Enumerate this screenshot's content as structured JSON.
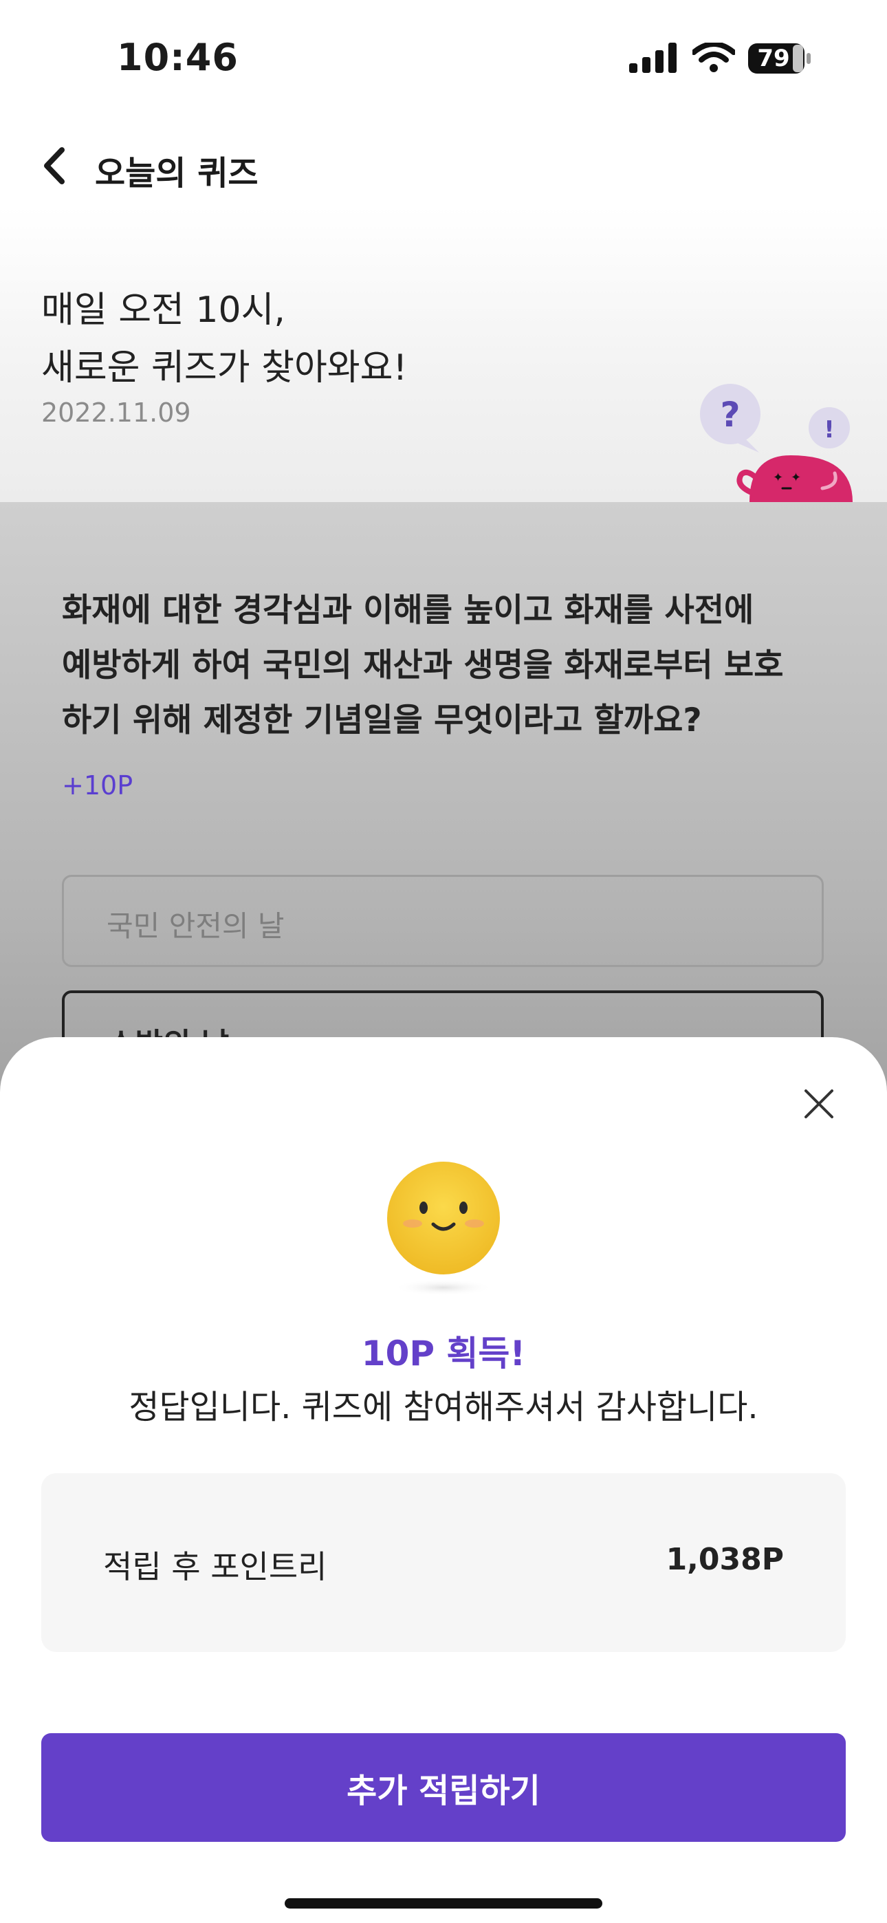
{
  "status_bar": {
    "time": "10:46",
    "battery": "79",
    "icons": [
      "signal-icon",
      "wifi-icon",
      "battery-icon"
    ]
  },
  "nav": {
    "title": "오늘의 퀴즈",
    "back_icon": "chevron-left-icon"
  },
  "hero": {
    "line1": "매일 오전 10시,",
    "line2": "새로운 퀴즈가 찾아와요!",
    "date": "2022.11.09",
    "mascot_marks": [
      "?",
      "!"
    ]
  },
  "quiz": {
    "question_lines": [
      "화재에 대한 경각심과 이해를 높이고 화재를 사전에",
      "예방하게 하여 국민의 재산과 생명을 화재로부터 보호",
      "하기 위해 제정한 기념일을 무엇이라고 할까요?"
    ],
    "points": "+10P",
    "options": [
      "국민 안전의 날",
      "소방의 날"
    ]
  },
  "result_sheet": {
    "title": "10P 획득!",
    "message": "정답입니다. 퀴즈에 참여해주셔서 감사합니다.",
    "balance_label": "적립 후 포인트리",
    "balance_value": "1,038P",
    "cta_label": "추가 적립하기"
  },
  "colors": {
    "accent": "#6440C9",
    "mascot": "#D6286A",
    "emoji": "#F4C52F"
  }
}
